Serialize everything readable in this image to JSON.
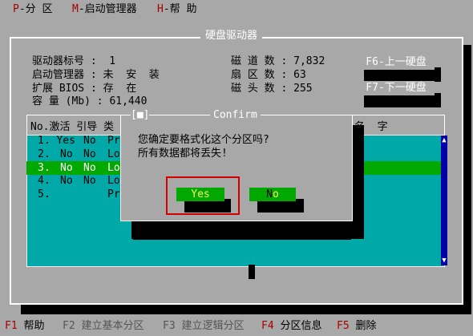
{
  "menubar": {
    "items": [
      {
        "key": "P",
        "label": "-分  区"
      },
      {
        "key": "M",
        "label": "-启动管理器"
      },
      {
        "key": "H",
        "label": "-帮  助"
      }
    ]
  },
  "panel": {
    "title": "硬盘驱动器",
    "info_left": [
      {
        "label": "驱动器标号 : ",
        "value": " 1"
      },
      {
        "label": "启动管理器 : ",
        "value": "未  安  装"
      },
      {
        "label": "扩展 BIOS : ",
        "value": "存  在"
      },
      {
        "label": "容 量 (Mb) : ",
        "value": "61,440"
      }
    ],
    "info_right": [
      {
        "label": "磁 道 数 : ",
        "value": "7,832"
      },
      {
        "label": "扇 区 数 : ",
        "value": "63"
      },
      {
        "label": "磁 头 数 : ",
        "value": "255"
      }
    ],
    "buttons": {
      "prev": "F6-上一硬盘",
      "next": "F7-下一硬盘"
    }
  },
  "table": {
    "header_left": "No.激活 引导 类",
    "header_right": "名  字",
    "rows": [
      {
        "no": "1.",
        "active": "Yes",
        "boot": "No",
        "type": "Pr"
      },
      {
        "no": "2.",
        "active": "No",
        "boot": "No",
        "type": "Lo"
      },
      {
        "no": "3.",
        "active": "No",
        "boot": "No",
        "type": "Lo"
      },
      {
        "no": "4.",
        "active": "No",
        "boot": "No",
        "type": "Lo"
      },
      {
        "no": "5.",
        "active": "",
        "boot": "",
        "type": "Pr"
      }
    ]
  },
  "dialog": {
    "close_glyph": "[■]",
    "title": "Confirm",
    "line1": "您确定要格式化这个分区吗?",
    "line2": "所有数据都将丢失!",
    "yes": "Yes",
    "no": "No"
  },
  "statusbar": {
    "items": [
      {
        "key": "F1",
        "label": " 帮助",
        "active": true
      },
      {
        "key": "F2",
        "label": " 建立基本分区",
        "active": false
      },
      {
        "key": "F3",
        "label": " 建立逻辑分区",
        "active": false
      },
      {
        "key": "F4",
        "label": " 分区信息",
        "active": true
      },
      {
        "key": "F5",
        "label": " 删除",
        "active": true
      }
    ]
  }
}
